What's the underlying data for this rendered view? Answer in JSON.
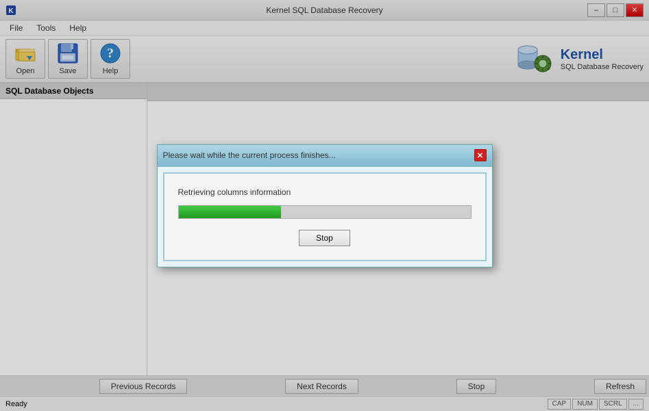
{
  "titleBar": {
    "title": "Kernel SQL Database Recovery",
    "controls": {
      "minimize": "–",
      "maximize": "□",
      "close": "✕"
    },
    "iconColor": "#2244aa"
  },
  "menuBar": {
    "items": [
      "File",
      "Tools",
      "Help"
    ]
  },
  "toolbar": {
    "buttons": [
      {
        "label": "Open",
        "name": "open-button"
      },
      {
        "label": "Save",
        "name": "save-button"
      },
      {
        "label": "Help",
        "name": "help-button"
      }
    ]
  },
  "logo": {
    "brand": "Kernel",
    "subtitle": "SQL Database Recovery"
  },
  "leftPanel": {
    "header": "SQL Database Objects"
  },
  "modal": {
    "title": "Please wait while the current process finishes...",
    "statusText": "Retrieving columns information",
    "progressPercent": 35,
    "stopButton": "Stop"
  },
  "bottomButtons": {
    "previous": "Previous Records",
    "next": "Next Records",
    "stop": "Stop",
    "refresh": "Refresh"
  },
  "statusBar": {
    "status": "Ready",
    "indicators": [
      "CAP",
      "NUM",
      "SCRL",
      "..."
    ]
  }
}
